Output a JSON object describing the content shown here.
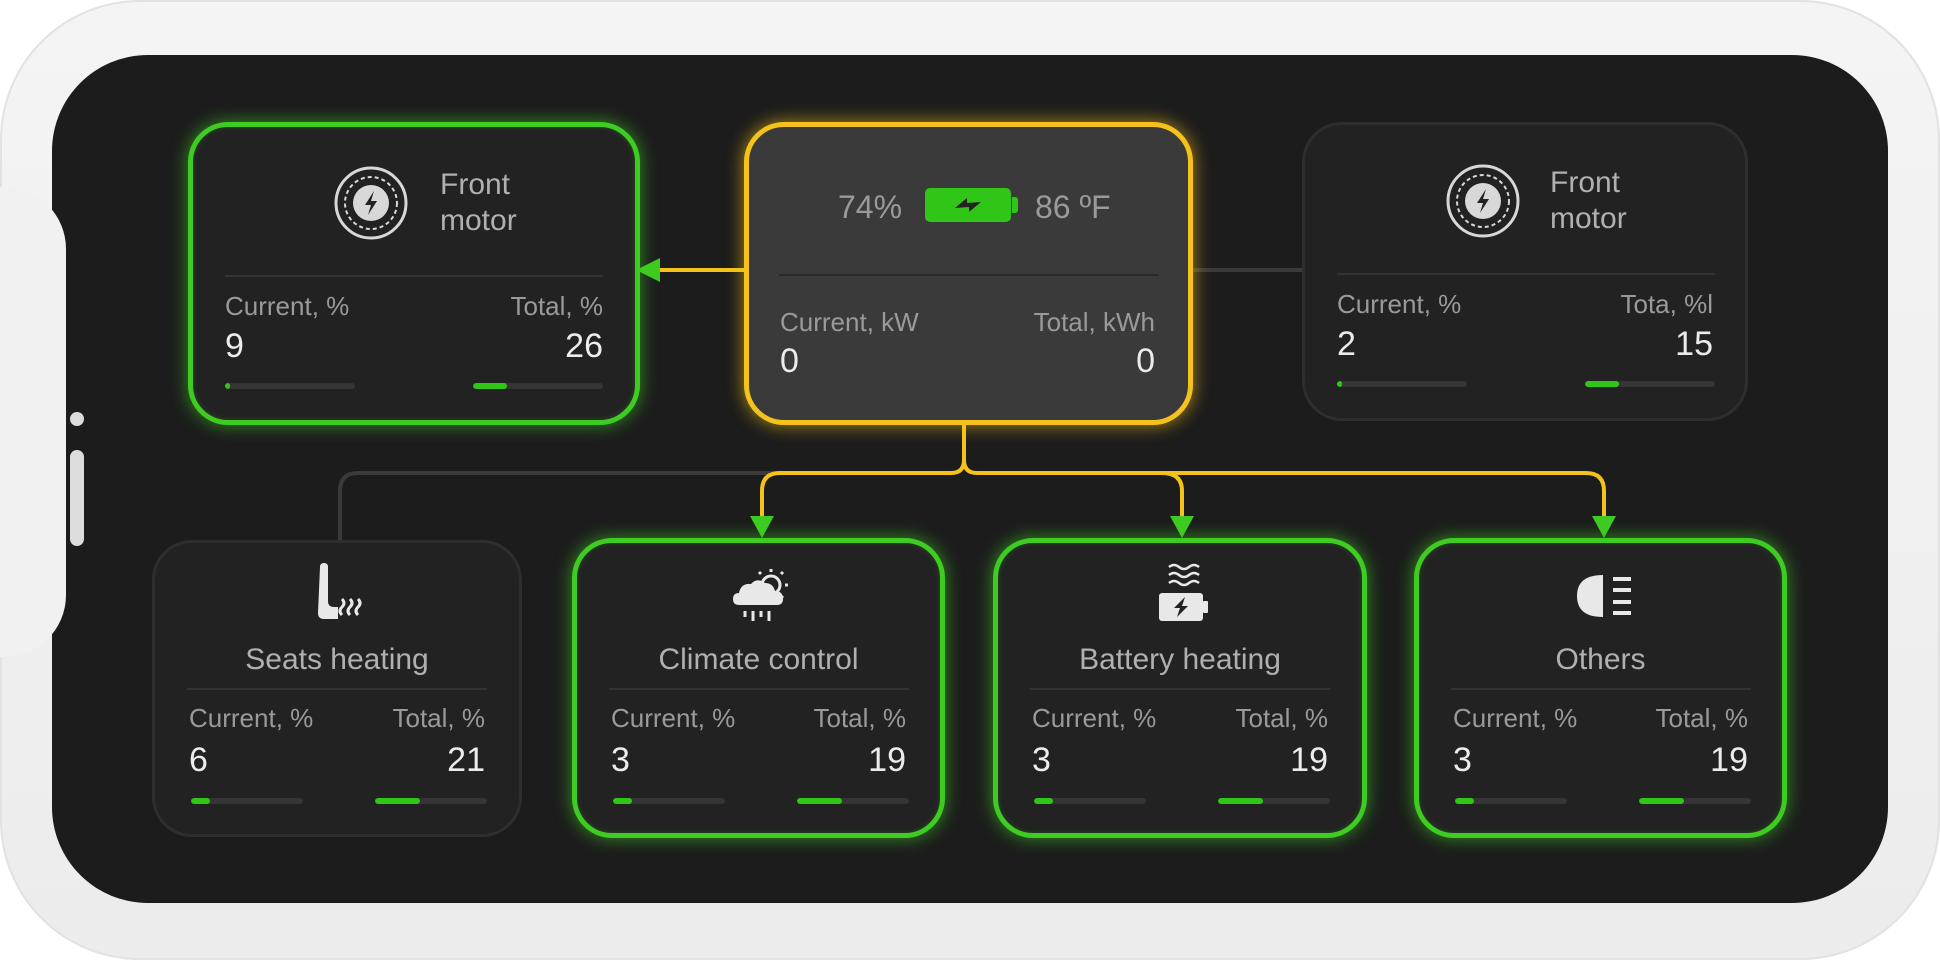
{
  "colors": {
    "active_green": "#3ecb22",
    "hub_yellow": "#f4c21a",
    "background": "#1c1c1c"
  },
  "hub": {
    "battery_icon": "battery-charging-icon",
    "charge": "74%",
    "temperature": "86 ºF",
    "current_label": "Current, kW",
    "current_value": "0",
    "total_label": "Total, kWh",
    "total_value": "0"
  },
  "front_motor_left": {
    "icon": "motor-icon",
    "title_line1": "Front",
    "title_line2": "motor",
    "current_label": "Current, %",
    "current_value": "9",
    "current_pct": 0.04,
    "total_label": "Total, %",
    "total_value": "26",
    "total_pct": 0.26,
    "active": true
  },
  "front_motor_right": {
    "icon": "motor-icon",
    "title_line1": "Front",
    "title_line2": "motor",
    "current_label": "Current, %",
    "current_value": "2",
    "current_pct": 0.04,
    "total_label": "Tota, %l",
    "total_value": "15",
    "total_pct": 0.26,
    "active": false
  },
  "consumers": [
    {
      "icon": "seat-heating-icon",
      "title": "Seats heating",
      "current_label": "Current, %",
      "current_value": "6",
      "current_pct": 0.17,
      "total_label": "Total, %",
      "total_value": "21",
      "total_pct": 0.4,
      "active": false
    },
    {
      "icon": "climate-icon",
      "title": "Climate control",
      "current_label": "Current, %",
      "current_value": "3",
      "current_pct": 0.17,
      "total_label": "Total, %",
      "total_value": "19",
      "total_pct": 0.4,
      "active": true
    },
    {
      "icon": "battery-heating-icon",
      "title": "Battery heating",
      "current_label": "Current, %",
      "current_value": "3",
      "current_pct": 0.17,
      "total_label": "Total, %",
      "total_value": "19",
      "total_pct": 0.4,
      "active": true
    },
    {
      "icon": "headlight-icon",
      "title": "Others",
      "current_label": "Current, %",
      "current_value": "3",
      "current_pct": 0.17,
      "total_label": "Total, %",
      "total_value": "19",
      "total_pct": 0.4,
      "active": true
    }
  ]
}
